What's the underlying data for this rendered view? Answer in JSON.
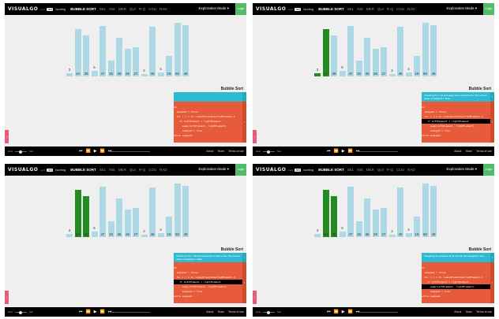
{
  "colors": {
    "bar": "#add8e6",
    "bar_sorted": "#228b22",
    "status_bg": "#2ebbd1",
    "code_bg": "#e85b3a",
    "highlight": "#000000"
  },
  "topbar": {
    "brand": "VISUALGO",
    "brand_suffix": ".net",
    "language": "/en",
    "topic": "/sorting",
    "algorithms": [
      "BUBBLE SORT",
      "SEL",
      "INS",
      "MER",
      "QUI",
      "R-Q",
      "COU",
      "RAD"
    ],
    "mode": "Exploration Mode ▾",
    "login": "Login"
  },
  "panel_title": "Bubble Sort",
  "bars": [
    3,
    44,
    38,
    5,
    47,
    15,
    36,
    26,
    27,
    2,
    46,
    4,
    19,
    50,
    48
  ],
  "code_lines": [
    "do",
    "  swapped = false",
    "  for i = 1 to indexOfLastUnsortedElement-1",
    "    if leftElement > rightElement",
    "      swap(leftElement, rightElement)",
    "      swapped = true",
    "while swapped"
  ],
  "panels": [
    {
      "sorted_bars": [],
      "status": "",
      "highlight_line": -1
    },
    {
      "sorted_bars": [
        0,
        1
      ],
      "status": "Checking if 3 > 44 and swap them if that is true. The current value of swapped = false.",
      "highlight_line": 3
    },
    {
      "sorted_bars": [
        1,
        2
      ],
      "status": "Checking if 44 > 38 and swap them if that is true. The current value of swapped = false.",
      "highlight_line": 3
    },
    {
      "sorted_bars": [
        1,
        2
      ],
      "status": "Swapping the positions of 44 and 38. Set swapped = true.",
      "highlight_line": 4
    }
  ],
  "bottombar": {
    "speed_label": "slow",
    "speed_value": "fast",
    "media": [
      "⏮",
      "⏪",
      "▶",
      "⏩",
      "⏭"
    ],
    "links": [
      "About",
      "Team",
      "Terms of use"
    ]
  },
  "arrows": {
    "next": "›",
    "side": "›"
  }
}
